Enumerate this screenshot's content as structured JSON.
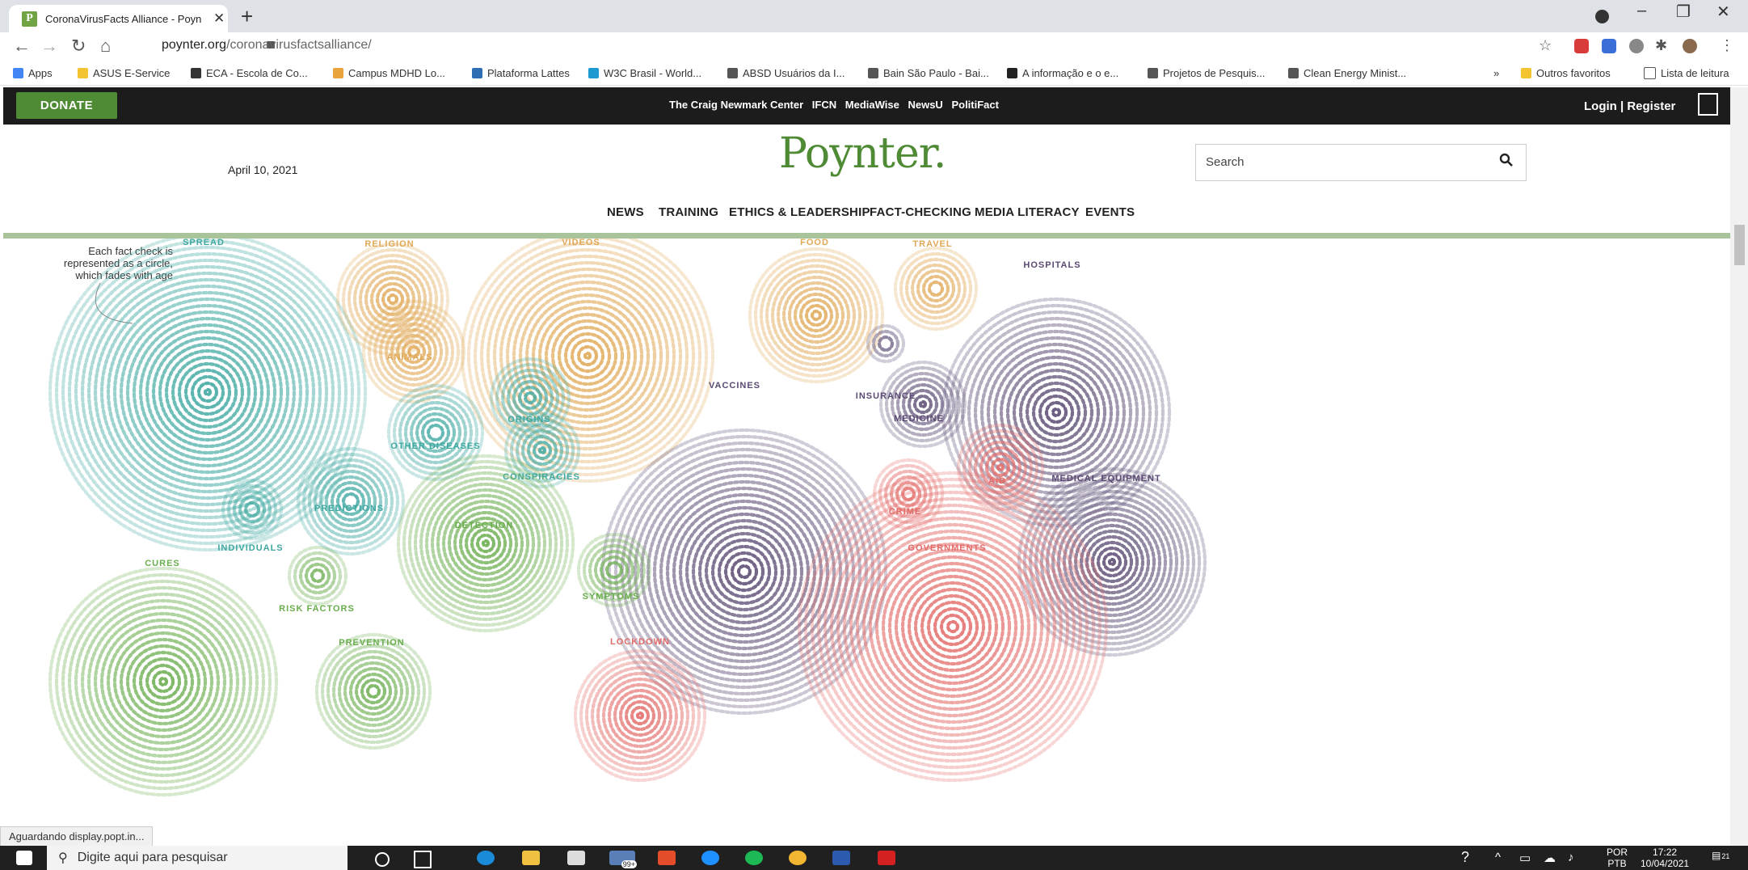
{
  "browser": {
    "tab_title": "CoronaVirusFacts Alliance - Poyn",
    "url_host": "poynter.org",
    "url_path": "/coronavirusfactsalliance/",
    "bookmarks": [
      {
        "label": "Apps",
        "color": "#4285f4"
      },
      {
        "label": "ASUS E-Service",
        "color": "#f4c430"
      },
      {
        "label": "ECA - Escola de Co...",
        "color": "#333333"
      },
      {
        "label": "Campus MDHD Lo...",
        "color": "#e8a33d"
      },
      {
        "label": "Plataforma Lattes",
        "color": "#2f6eb5"
      },
      {
        "label": "W3C Brasil - World...",
        "color": "#1d9bd1"
      },
      {
        "label": "ABSD Usuários da I...",
        "color": "#555555"
      },
      {
        "label": "Bain São Paulo - Bai...",
        "color": "#555555"
      },
      {
        "label": "A informação e o e...",
        "color": "#222222"
      },
      {
        "label": "Projetos de Pesquis...",
        "color": "#555555"
      },
      {
        "label": "Clean Energy Minist...",
        "color": "#555555"
      }
    ],
    "bookmark_overflow": "»",
    "other_bookmarks": "Outros favoritos",
    "reading_list": "Lista de leitura",
    "status": "Aguardando display.popt.in..."
  },
  "site": {
    "donate": "DONATE",
    "top_links": [
      "The Craig Newmark Center",
      "IFCN",
      "MediaWise",
      "NewsU",
      "PolitiFact"
    ],
    "login": "Login | Register",
    "date": "April 10, 2021",
    "logo": "Poynter.",
    "search_placeholder": "Search",
    "nav": [
      "NEWS",
      "TRAINING",
      "ETHICS & LEADERSHIP",
      "FACT-CHECKING",
      "MEDIA LITERACY",
      "EVENTS"
    ],
    "viz_note": "Each fact check is represented as a circle, which fades with age"
  },
  "colors": {
    "brand": "#4f8a35",
    "teal": "#3fa8a1",
    "tan": "#e0a856",
    "purple": "#5a4a72",
    "green": "#6aad4e",
    "red": "#e26b68"
  },
  "bubbles": [
    {
      "label": "SPREAD",
      "color": "teal"
    },
    {
      "label": "RELIGION",
      "color": "tan"
    },
    {
      "label": "VIDEOS",
      "color": "tan"
    },
    {
      "label": "FOOD",
      "color": "tan"
    },
    {
      "label": "TRAVEL",
      "color": "tan"
    },
    {
      "label": "HOSPITALS",
      "color": "purple"
    },
    {
      "label": "ANIMALS",
      "color": "tan"
    },
    {
      "label": "VACCINES",
      "color": "purple"
    },
    {
      "label": "INSURANCE",
      "color": "purple"
    },
    {
      "label": "MEDICINE",
      "color": "purple"
    },
    {
      "label": "ORIGINS",
      "color": "teal"
    },
    {
      "label": "OTHER DISEASES",
      "color": "teal"
    },
    {
      "label": "CONSPIRACIES",
      "color": "teal"
    },
    {
      "label": "PREDICTIONS",
      "color": "teal"
    },
    {
      "label": "DETECTION",
      "color": "green"
    },
    {
      "label": "AID",
      "color": "red"
    },
    {
      "label": "MEDICAL EQUIPMENT",
      "color": "purple"
    },
    {
      "label": "CRIME",
      "color": "red"
    },
    {
      "label": "GOVERNMENTS",
      "color": "red"
    },
    {
      "label": "INDIVIDUALS",
      "color": "teal"
    },
    {
      "label": "CURES",
      "color": "green"
    },
    {
      "label": "RISK FACTORS",
      "color": "green"
    },
    {
      "label": "SYMPTOMS",
      "color": "green"
    },
    {
      "label": "PREVENTION",
      "color": "green"
    },
    {
      "label": "LOCKDOWN",
      "color": "red"
    }
  ],
  "taskbar": {
    "search_placeholder": "Digite aqui para pesquisar",
    "mail_badge": "99+",
    "lang": "POR",
    "lang2": "PTB",
    "time": "17:22",
    "date": "10/04/2021",
    "notif": "21"
  }
}
